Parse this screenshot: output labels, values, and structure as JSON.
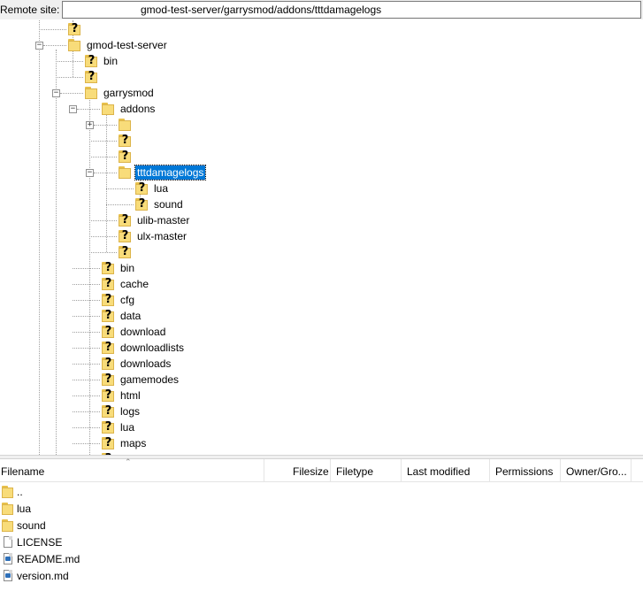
{
  "remote_site": {
    "label": "Remote site:",
    "path": "gmod-test-server/garrysmod/addons/tttdamagelogs"
  },
  "tree": {
    "selected": "tttdamagelogs",
    "nodes": [
      {
        "label": "",
        "icon": "unknown",
        "expander": "none"
      },
      {
        "label": "gmod-test-server",
        "icon": "folder",
        "expander": "minus"
      },
      {
        "label": "bin",
        "icon": "unknown",
        "expander": "none"
      },
      {
        "label": "",
        "icon": "unknown",
        "expander": "none"
      },
      {
        "label": "garrysmod",
        "icon": "folder",
        "expander": "minus"
      },
      {
        "label": "addons",
        "icon": "folder",
        "expander": "minus"
      },
      {
        "label": "",
        "icon": "folder",
        "expander": "plus"
      },
      {
        "label": "",
        "icon": "unknown",
        "expander": "none"
      },
      {
        "label": "",
        "icon": "unknown",
        "expander": "none"
      },
      {
        "label": "tttdamagelogs",
        "icon": "folder",
        "expander": "minus"
      },
      {
        "label": "lua",
        "icon": "unknown",
        "expander": "none"
      },
      {
        "label": "sound",
        "icon": "unknown",
        "expander": "none"
      },
      {
        "label": "ulib-master",
        "icon": "unknown",
        "expander": "none"
      },
      {
        "label": "ulx-master",
        "icon": "unknown",
        "expander": "none"
      },
      {
        "label": "",
        "icon": "unknown",
        "expander": "none"
      },
      {
        "label": "bin",
        "icon": "unknown",
        "expander": "none"
      },
      {
        "label": "cache",
        "icon": "unknown",
        "expander": "none"
      },
      {
        "label": "cfg",
        "icon": "unknown",
        "expander": "none"
      },
      {
        "label": "data",
        "icon": "unknown",
        "expander": "none"
      },
      {
        "label": "download",
        "icon": "unknown",
        "expander": "none"
      },
      {
        "label": "downloadlists",
        "icon": "unknown",
        "expander": "none"
      },
      {
        "label": "downloads",
        "icon": "unknown",
        "expander": "none"
      },
      {
        "label": "gamemodes",
        "icon": "unknown",
        "expander": "none"
      },
      {
        "label": "html",
        "icon": "unknown",
        "expander": "none"
      },
      {
        "label": "logs",
        "icon": "unknown",
        "expander": "none"
      },
      {
        "label": "lua",
        "icon": "unknown",
        "expander": "none"
      },
      {
        "label": "maps",
        "icon": "unknown",
        "expander": "none"
      },
      {
        "label": "",
        "icon": "unknown",
        "expander": "none"
      }
    ]
  },
  "file_list": {
    "columns": [
      "Filename",
      "Filesize",
      "Filetype",
      "Last modified",
      "Permissions",
      "Owner/Gro..."
    ],
    "rows": [
      {
        "name": "..",
        "icon": "folder"
      },
      {
        "name": "lua",
        "icon": "folder"
      },
      {
        "name": "sound",
        "icon": "folder"
      },
      {
        "name": "LICENSE",
        "icon": "file"
      },
      {
        "name": "README.md",
        "icon": "md-file"
      },
      {
        "name": "version.md",
        "icon": "md-file"
      }
    ]
  },
  "colors": {
    "selection": "#0078d7",
    "folder": "#f8dc7a",
    "folder_edge": "#dcb44a",
    "tree_lines": "#a0a0a0"
  }
}
